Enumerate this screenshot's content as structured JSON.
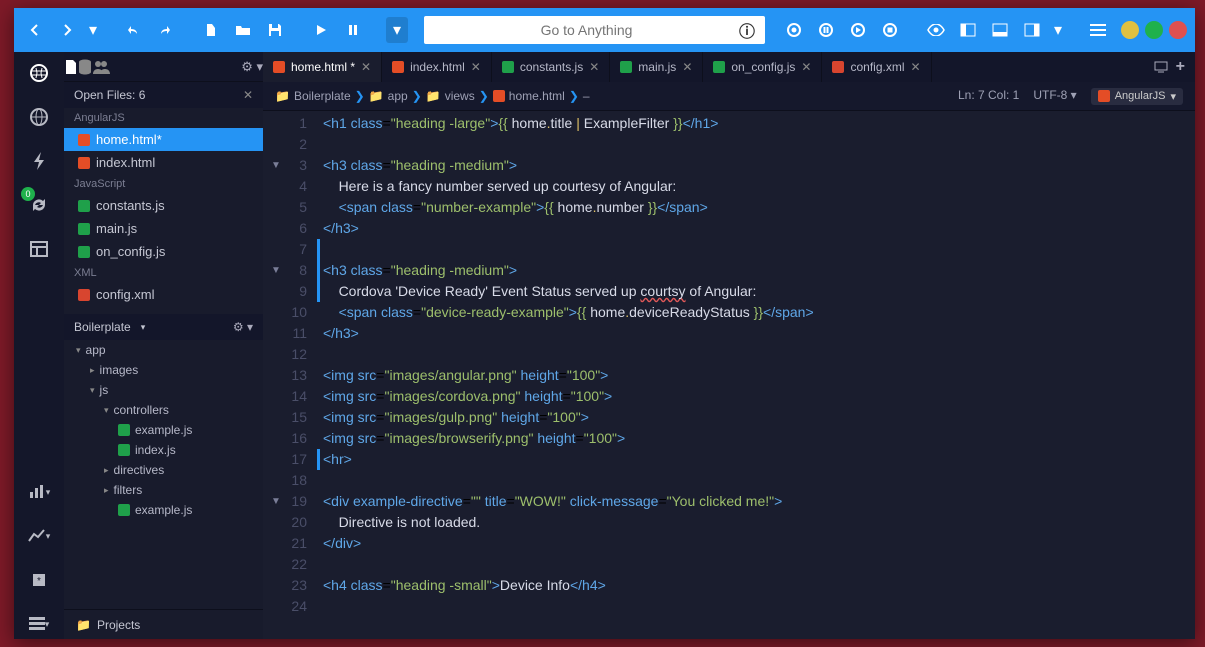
{
  "search": {
    "placeholder": "Go to Anything"
  },
  "toolbar_circles": [
    "#e0c041",
    "#1fb14c",
    "#e05050"
  ],
  "sidebar": {
    "openfiles_label": "Open Files: 6",
    "groups": [
      "AngularJS",
      "JavaScript",
      "XML"
    ],
    "files": [
      {
        "group": 0,
        "name": "home.html*",
        "icon": "ic-html",
        "sel": true
      },
      {
        "group": 0,
        "name": "index.html",
        "icon": "ic-html"
      },
      {
        "group": 1,
        "name": "constants.js",
        "icon": "ic-js"
      },
      {
        "group": 1,
        "name": "main.js",
        "icon": "ic-js"
      },
      {
        "group": 1,
        "name": "on_config.js",
        "icon": "ic-js"
      },
      {
        "group": 2,
        "name": "config.xml",
        "icon": "ic-xml"
      }
    ],
    "project": "Boilerplate",
    "tree": [
      {
        "depth": 0,
        "label": "app",
        "exp": "▾"
      },
      {
        "depth": 1,
        "label": "images",
        "exp": "▸"
      },
      {
        "depth": 1,
        "label": "js",
        "exp": "▾"
      },
      {
        "depth": 2,
        "label": "controllers",
        "exp": "▾"
      },
      {
        "depth": 3,
        "label": "example.js",
        "icon": "ic-js"
      },
      {
        "depth": 3,
        "label": "index.js",
        "icon": "ic-js"
      },
      {
        "depth": 2,
        "label": "directives",
        "exp": "▸"
      },
      {
        "depth": 2,
        "label": "filters",
        "exp": "▸"
      },
      {
        "depth": 3,
        "label": "example.js",
        "icon": "ic-js"
      }
    ],
    "projects_label": "Projects"
  },
  "tabs": [
    {
      "name": "home.html *",
      "icon": "ic-html",
      "active": true
    },
    {
      "name": "index.html",
      "icon": "ic-html"
    },
    {
      "name": "constants.js",
      "icon": "ic-js"
    },
    {
      "name": "main.js",
      "icon": "ic-js"
    },
    {
      "name": "on_config.js",
      "icon": "ic-js"
    },
    {
      "name": "config.xml",
      "icon": "ic-xml"
    }
  ],
  "breadcrumb": [
    "Boilerplate",
    "app",
    "views",
    "home.html",
    "–"
  ],
  "status": {
    "pos": "Ln: 7 Col: 1",
    "enc": "UTF-8",
    "lang": "AngularJS"
  },
  "badge_count": "0",
  "code": [
    {
      "n": 1,
      "html": "<span class='tok-tag'>&lt;h1</span> <span class='tok-attr'>class</span>=<span class='tok-str'>\"heading -large\"</span><span class='tok-tag'>&gt;</span><span class='tok-punct'>{{</span> <span class='tok-txt'>home</span><span class='tok-expr'>.</span><span class='tok-txt'>title </span><span class='tok-expr'>|</span> <span class='tok-txt'>ExampleFilter</span> <span class='tok-punct'>}}</span><span class='tok-tag'>&lt;/h1&gt;</span>"
    },
    {
      "n": 2,
      "html": ""
    },
    {
      "n": 3,
      "fold": true,
      "html": "<span class='tok-tag'>&lt;h3</span> <span class='tok-attr'>class</span>=<span class='tok-str'>\"heading -medium\"</span><span class='tok-tag'>&gt;</span>"
    },
    {
      "n": 4,
      "html": "    <span class='tok-txt'>Here is a fancy number served up courtesy of Angular:</span>"
    },
    {
      "n": 5,
      "html": "    <span class='tok-tag'>&lt;span</span> <span class='tok-attr'>class</span>=<span class='tok-str'>\"number-example\"</span><span class='tok-tag'>&gt;</span><span class='tok-punct'>{{</span> <span class='tok-txt'>home</span><span class='tok-expr'>.</span><span class='tok-txt'>number</span> <span class='tok-punct'>}}</span><span class='tok-tag'>&lt;/span&gt;</span>"
    },
    {
      "n": 6,
      "html": "<span class='tok-tag'>&lt;/h3&gt;</span>"
    },
    {
      "n": 7,
      "cur": true,
      "html": ""
    },
    {
      "n": 8,
      "fold": true,
      "cur": true,
      "html": "<span class='tok-tag'>&lt;h3</span> <span class='tok-attr'>class</span>=<span class='tok-str'>\"heading -medium\"</span><span class='tok-tag'>&gt;</span>"
    },
    {
      "n": 9,
      "cur": true,
      "html": "    <span class='tok-txt'>Cordova 'Device Ready' Event Status served up <span class='underline-err'>courtsy</span> of Angular:</span>"
    },
    {
      "n": 10,
      "html": "    <span class='tok-tag'>&lt;span</span> <span class='tok-attr'>class</span>=<span class='tok-str'>\"device-ready-example\"</span><span class='tok-tag'>&gt;</span><span class='tok-punct'>{{</span> <span class='tok-txt'>home</span><span class='tok-expr'>.</span><span class='tok-txt'>deviceReadyStatus</span> <span class='tok-punct'>}}</span><span class='tok-tag'>&lt;/span&gt;</span>"
    },
    {
      "n": 11,
      "html": "<span class='tok-tag'>&lt;/h3&gt;</span>"
    },
    {
      "n": 12,
      "html": ""
    },
    {
      "n": 13,
      "html": "<span class='tok-tag'>&lt;img</span> <span class='tok-attr'>src</span>=<span class='tok-str'>\"images/angular.png\"</span> <span class='tok-attr'>height</span>=<span class='tok-str'>\"100\"</span><span class='tok-tag'>&gt;</span>"
    },
    {
      "n": 14,
      "html": "<span class='tok-tag'>&lt;img</span> <span class='tok-attr'>src</span>=<span class='tok-str'>\"images/cordova.png\"</span> <span class='tok-attr'>height</span>=<span class='tok-str'>\"100\"</span><span class='tok-tag'>&gt;</span>"
    },
    {
      "n": 15,
      "html": "<span class='tok-tag'>&lt;img</span> <span class='tok-attr'>src</span>=<span class='tok-str'>\"images/gulp.png\"</span> <span class='tok-attr'>height</span>=<span class='tok-str'>\"100\"</span><span class='tok-tag'>&gt;</span>"
    },
    {
      "n": 16,
      "html": "<span class='tok-tag'>&lt;img</span> <span class='tok-attr'>src</span>=<span class='tok-str'>\"images/browserify.png\"</span> <span class='tok-attr'>height</span>=<span class='tok-str'>\"100\"</span><span class='tok-tag'>&gt;</span>"
    },
    {
      "n": 17,
      "cur": true,
      "html": "<span class='tok-tag'>&lt;hr&gt;</span>"
    },
    {
      "n": 18,
      "html": ""
    },
    {
      "n": 19,
      "fold": true,
      "html": "<span class='tok-tag'>&lt;div</span> <span class='tok-attr'>example-directive</span>=<span class='tok-str'>\"\"</span> <span class='tok-attr'>title</span>=<span class='tok-str'>\"WOW!\"</span> <span class='tok-attr'>click-message</span>=<span class='tok-str'>\"You clicked me!\"</span><span class='tok-tag'>&gt;</span>"
    },
    {
      "n": 20,
      "html": "    <span class='tok-txt'>Directive is not loaded.</span>"
    },
    {
      "n": 21,
      "html": "<span class='tok-tag'>&lt;/div&gt;</span>"
    },
    {
      "n": 22,
      "html": ""
    },
    {
      "n": 23,
      "html": "<span class='tok-tag'>&lt;h4</span> <span class='tok-attr'>class</span>=<span class='tok-str'>\"heading -small\"</span><span class='tok-tag'>&gt;</span><span class='tok-txt'>Device Info</span><span class='tok-tag'>&lt;/h4&gt;</span>"
    },
    {
      "n": 24,
      "html": ""
    }
  ]
}
